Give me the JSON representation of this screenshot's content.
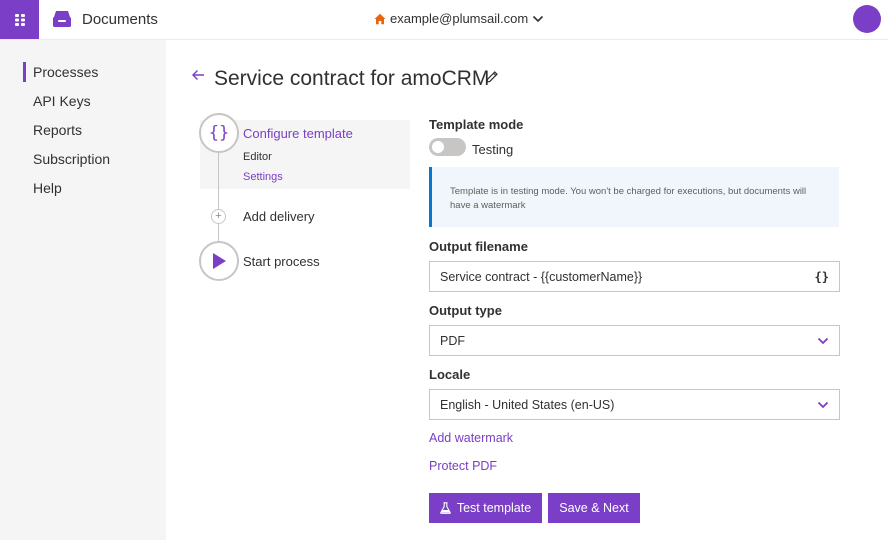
{
  "header": {
    "app_title": "Documents",
    "account_email": "example@plumsail.com",
    "brand_color": "#7a3fc6"
  },
  "sidebar": {
    "items": [
      {
        "label": "Processes",
        "active": true
      },
      {
        "label": "API Keys",
        "active": false
      },
      {
        "label": "Reports",
        "active": false
      },
      {
        "label": "Subscription",
        "active": false
      },
      {
        "label": "Help",
        "active": false
      }
    ]
  },
  "page": {
    "title": "Service contract for amoCRM"
  },
  "stepper": {
    "steps": [
      {
        "label": "Configure template",
        "icon": "curly-braces-icon",
        "substeps": [
          "Editor",
          "Settings"
        ]
      },
      {
        "label": "Add delivery",
        "icon": "plus-icon"
      },
      {
        "label": "Start process",
        "icon": "play-icon"
      }
    ]
  },
  "form": {
    "template_mode": {
      "label": "Template mode",
      "toggle_label": "Testing",
      "info_text": "Template is in testing mode. You won't be charged for executions, but documents will have a watermark"
    },
    "output_filename": {
      "label": "Output filename",
      "value": "Service contract - {{customerName}}",
      "token_button": "{}"
    },
    "output_type": {
      "label": "Output type",
      "value": "PDF"
    },
    "locale": {
      "label": "Locale",
      "value": "English - United States (en-US)"
    },
    "add_watermark_link": "Add watermark",
    "protect_pdf_link": "Protect PDF"
  },
  "actions": {
    "test_template": "Test template",
    "save_next": "Save & Next"
  }
}
